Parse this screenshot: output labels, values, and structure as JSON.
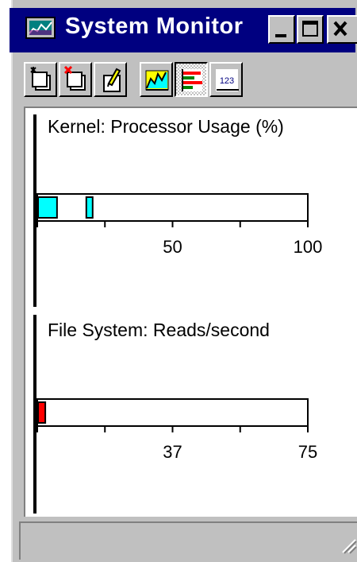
{
  "window": {
    "title": "System Monitor",
    "title_bar_color": "#000080"
  },
  "title_bar": {
    "buttons": [
      {
        "name": "minimize",
        "icon": "minimize-icon"
      },
      {
        "name": "maximize",
        "icon": "maximize-icon"
      },
      {
        "name": "close",
        "icon": "close-icon"
      }
    ]
  },
  "toolbar": {
    "buttons": [
      {
        "name": "add-item",
        "icon": "add-item-icon",
        "pressed": false
      },
      {
        "name": "remove-item",
        "icon": "remove-item-icon",
        "pressed": false
      },
      {
        "name": "edit-item",
        "icon": "edit-item-icon",
        "pressed": false
      },
      {
        "name": "line-chart-view",
        "icon": "line-chart-icon",
        "pressed": false
      },
      {
        "name": "bar-chart-view",
        "icon": "bar-chart-icon",
        "pressed": true
      },
      {
        "name": "numeric-view",
        "icon": "numeric-view-icon",
        "label": "123",
        "pressed": false
      }
    ]
  },
  "chart_data": [
    {
      "type": "bar",
      "orientation": "horizontal",
      "title": "Kernel: Processor Usage (%)",
      "xlim": [
        0,
        100
      ],
      "ticks": [
        0,
        25,
        50,
        75,
        100
      ],
      "tick_labels": [
        "50",
        "100"
      ],
      "tick_label_values": [
        50,
        100
      ],
      "current": 7,
      "peak": 19,
      "colors": {
        "current": "#00ffff",
        "peak": "#00ffff"
      }
    },
    {
      "type": "bar",
      "orientation": "horizontal",
      "title": "File System: Reads/second",
      "xlim": [
        0,
        75
      ],
      "ticks": [
        0,
        18.75,
        37.5,
        56.25,
        75
      ],
      "tick_labels": [
        "37",
        "75"
      ],
      "tick_label_values": [
        37.5,
        75
      ],
      "current": 2,
      "colors": {
        "current": "#ff0000"
      }
    }
  ]
}
